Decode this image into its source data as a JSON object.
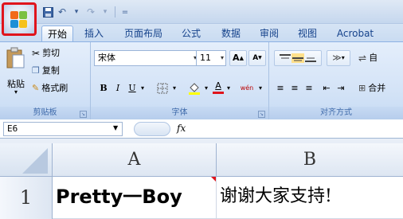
{
  "quick_access": {
    "save": "save-icon",
    "undo": "↶",
    "redo": "↷",
    "more": "="
  },
  "tabs": [
    {
      "label": "开始",
      "active": true
    },
    {
      "label": "插入",
      "active": false
    },
    {
      "label": "页面布局",
      "active": false
    },
    {
      "label": "公式",
      "active": false
    },
    {
      "label": "数据",
      "active": false
    },
    {
      "label": "审阅",
      "active": false
    },
    {
      "label": "视图",
      "active": false
    },
    {
      "label": "Acrobat",
      "active": false
    }
  ],
  "clipboard": {
    "paste": "粘贴",
    "cut": "剪切",
    "copy": "复制",
    "format_painter": "格式刷",
    "group_label": "剪贴板"
  },
  "font": {
    "name": "宋体",
    "size": "11",
    "grow": "A",
    "shrink": "A",
    "bold": "B",
    "italic": "I",
    "underline": "U",
    "font_color": "A",
    "phonetic": "wén",
    "group_label": "字体"
  },
  "alignment": {
    "wrap": "自",
    "merge": "合并",
    "group_label": "对齐方式"
  },
  "formula_bar": {
    "name_box": "E6",
    "fx": "fx"
  },
  "grid": {
    "columns": [
      "A",
      "B"
    ],
    "rows": [
      {
        "number": "1",
        "cells": [
          "Pretty一Boy",
          "谢谢大家支持!"
        ]
      }
    ]
  },
  "colors": {
    "accent": "#e0141c",
    "ribbon": "#d5e4f7",
    "tab_text": "#15428b"
  }
}
